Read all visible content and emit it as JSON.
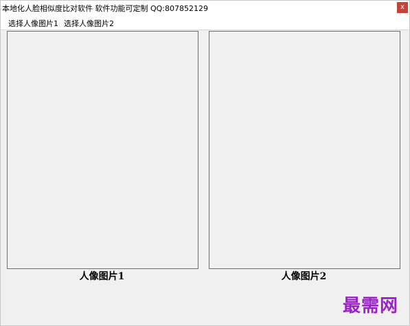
{
  "window": {
    "title": "本地化人脸相似度比对软件 软件功能可定制  QQ:807852129",
    "close_label": "x"
  },
  "menu": {
    "items": [
      {
        "label": "选择人像图片1"
      },
      {
        "label": "选择人像图片2"
      }
    ]
  },
  "panels": [
    {
      "caption": "人像图片1"
    },
    {
      "caption": "人像图片2"
    }
  ],
  "watermark": {
    "text": "最需网",
    "color": "#9b21c9"
  }
}
